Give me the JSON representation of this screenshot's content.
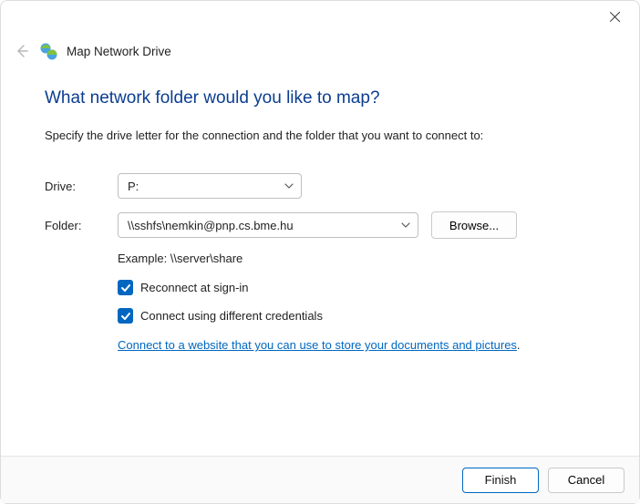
{
  "window": {
    "title": "Map Network Drive"
  },
  "heading": "What network folder would you like to map?",
  "instruction": "Specify the drive letter for the connection and the folder that you want to connect to:",
  "form": {
    "drive_label": "Drive:",
    "drive_value": "P:",
    "folder_label": "Folder:",
    "folder_value": "\\\\sshfs\\nemkin@pnp.cs.bme.hu",
    "browse_label": "Browse...",
    "example_text": "Example: \\\\server\\share",
    "reconnect_label": "Reconnect at sign-in",
    "credentials_label": "Connect using different credentials",
    "link_text": "Connect to a website that you can use to store your documents and pictures"
  },
  "footer": {
    "finish_label": "Finish",
    "cancel_label": "Cancel"
  }
}
